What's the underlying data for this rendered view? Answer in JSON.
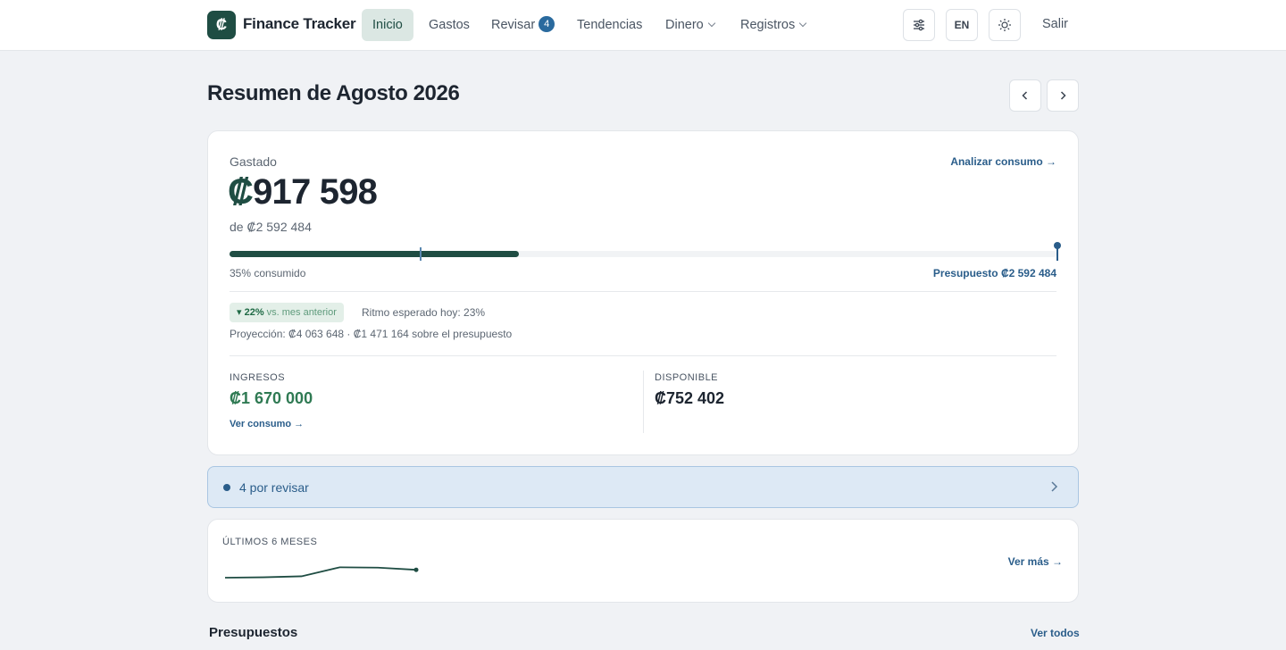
{
  "brand": {
    "logo_glyph": "₡",
    "name": "Finance Tracker"
  },
  "nav": {
    "items": [
      {
        "label": "Inicio",
        "active": true
      },
      {
        "label": "Gastos"
      },
      {
        "label": "Revisar",
        "badge": "4"
      },
      {
        "label": "Tendencias"
      },
      {
        "label": "Dinero",
        "dropdown": true
      },
      {
        "label": "Registros",
        "dropdown": true
      }
    ],
    "settings_icon": "sliders-icon",
    "language": "EN",
    "theme_icon": "sun-icon",
    "logout": "Salir"
  },
  "page": {
    "title": "Resumen de Agosto 2026",
    "prev_icon": "chevron-left-icon",
    "next_icon": "chevron-right-icon"
  },
  "summary": {
    "spent_label": "Gastado",
    "analyze_link": "Analizar consumo →",
    "spent_currency": "₡",
    "spent_amount": "917 598",
    "of_budget": "de ₡2 592 484",
    "progress_fraction": 0.35,
    "expected_pace_fraction": 0.23,
    "consumed_label": "35% consumido",
    "budget_label": "Presupuesto ₡2 592 484",
    "trend_chip": {
      "arrow": "▾",
      "value": "22%",
      "suffix": "vs. mes anterior"
    },
    "pace_text": "Ritmo esperado hoy: 23%",
    "projection": "Proyección: ₡4 063 648 · ₡1 471 164 sobre el presupuesto",
    "income_label": "INGRESOS",
    "income_value": "₡1 670 000",
    "income_link": "Ver consumo →",
    "available_label": "DISPONIBLE",
    "available_value": "₡752 402"
  },
  "review": {
    "text": "4 por revisar",
    "chevron_icon": "chevron-right-icon"
  },
  "trend": {
    "label": "ÚLTIMOS 6 MESES",
    "link": "Ver más →",
    "series": [
      1.0,
      0.98,
      0.93,
      0.47,
      0.49,
      0.6
    ]
  },
  "budgets": {
    "title": "Presupuestos",
    "link": "Ver todos"
  },
  "colors": {
    "brand": "#1f4d43",
    "accent_blue": "#2a5d8a",
    "income_green": "#2f7a53",
    "review_bg": "#dde9f5"
  }
}
